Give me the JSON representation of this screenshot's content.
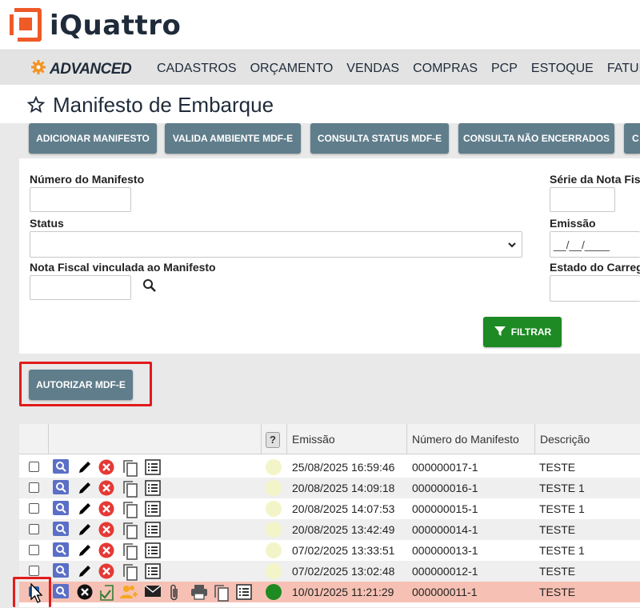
{
  "app": {
    "name": "iQuattro",
    "edition": "ADVANCED"
  },
  "nav": {
    "items": [
      "CADASTROS",
      "ORÇAMENTO",
      "VENDAS",
      "COMPRAS",
      "PCP",
      "ESTOQUE",
      "FATURA"
    ]
  },
  "page": {
    "title": "Manifesto de Embarque"
  },
  "actions": {
    "add": "ADICIONAR MANIFESTO",
    "validate": "VALIDA AMBIENTE MDF-E",
    "status": "CONSULTA STATUS MDF-E",
    "not_closed": "CONSULTA NÃO ENCERRADOS",
    "more": "C"
  },
  "filters": {
    "numero_label": "Número do Manifesto",
    "numero_value": "",
    "serie_label": "Série da Nota Fis",
    "status_label": "Status",
    "status_value": "",
    "emissao_label": "Emissão",
    "emissao_placeholder": "__/__/____",
    "nota_label": "Nota Fiscal vinculada ao Manifesto",
    "estado_label": "Estado do Carreg",
    "filter_button": "FILTRAR"
  },
  "authorize": {
    "label": "AUTORIZAR MDF-E"
  },
  "table": {
    "help": "?",
    "headers": {
      "emissao": "Emissão",
      "numero": "Número do Manifesto",
      "descricao": "Descrição"
    },
    "rows": [
      {
        "emissao": "25/08/2025 16:59:46",
        "numero": "000000017-1",
        "descricao": "TESTE",
        "status": "pending",
        "checked": false
      },
      {
        "emissao": "20/08/2025 14:09:18",
        "numero": "000000016-1",
        "descricao": "TESTE 1",
        "status": "pending",
        "checked": false
      },
      {
        "emissao": "20/08/2025 14:07:53",
        "numero": "000000015-1",
        "descricao": "TESTE 1",
        "status": "pending",
        "checked": false
      },
      {
        "emissao": "20/08/2025 13:42:49",
        "numero": "000000014-1",
        "descricao": "TESTE",
        "status": "pending",
        "checked": false
      },
      {
        "emissao": "07/02/2025 13:33:51",
        "numero": "000000013-1",
        "descricao": "TESTE 1",
        "status": "pending",
        "checked": false
      },
      {
        "emissao": "07/02/2025 13:02:48",
        "numero": "000000012-1",
        "descricao": "TESTE",
        "status": "pending",
        "checked": false
      },
      {
        "emissao": "10/01/2025 11:21:29",
        "numero": "000000011-1",
        "descricao": "TESTE",
        "status": "authorized",
        "checked": true
      }
    ]
  },
  "colors": {
    "accent": "#607d8b",
    "logo": "#ef5a28",
    "green": "#1d8a23",
    "highlight": "#e21b1b",
    "selected_row": "#f6c1b4"
  }
}
